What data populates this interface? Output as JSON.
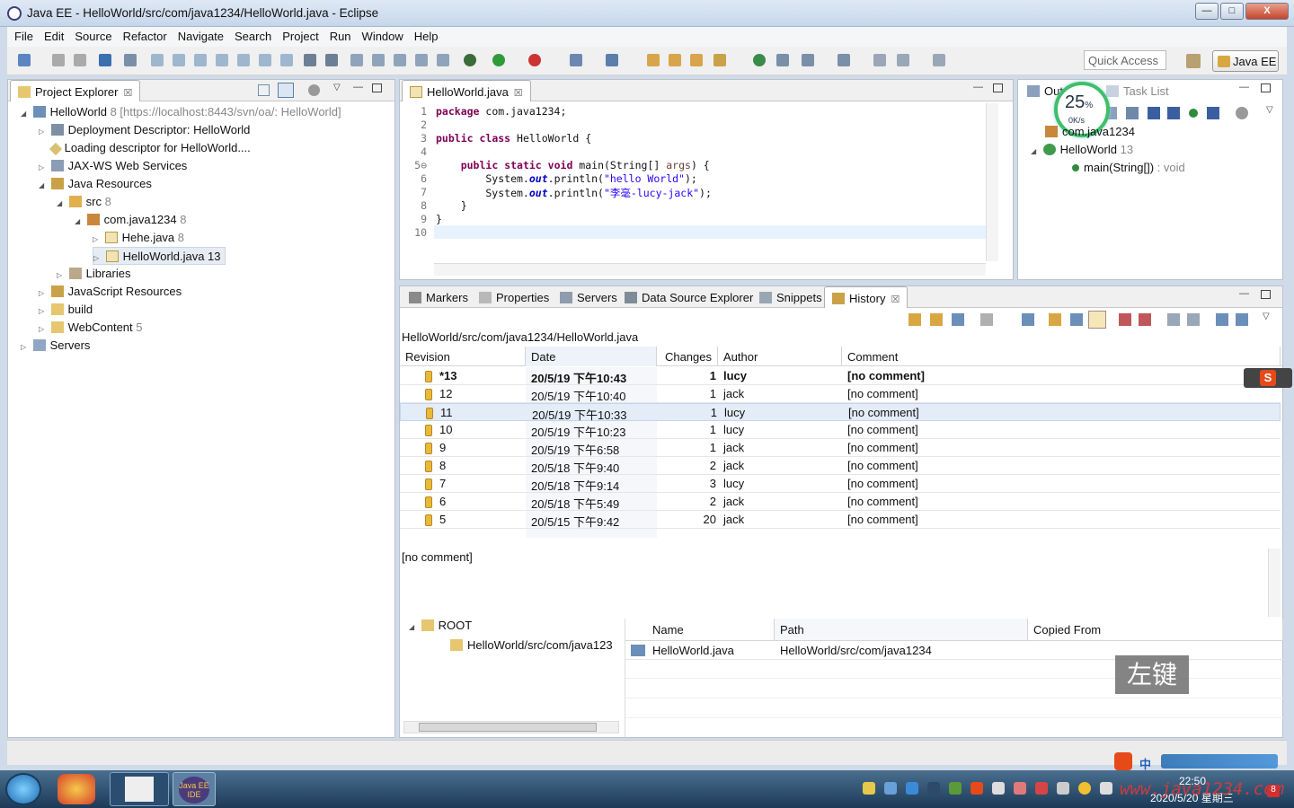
{
  "window": {
    "title": "Java EE - HelloWorld/src/com/java1234/HelloWorld.java - Eclipse",
    "controls": [
      "—",
      "□",
      "X"
    ]
  },
  "menu": [
    "File",
    "Edit",
    "Source",
    "Refactor",
    "Navigate",
    "Search",
    "Project",
    "Run",
    "Window",
    "Help"
  ],
  "toolbar": {
    "quick_access": "Quick Access",
    "perspective": "Java EE"
  },
  "project_explorer": {
    "title": "Project Explorer",
    "items": [
      {
        "label": "HelloWorld",
        "extra": "8 [https://localhost:8443/svn/oa/: HelloWorld]"
      },
      {
        "label": "Deployment Descriptor: HelloWorld",
        "extra": ""
      },
      {
        "label": "Loading descriptor for HelloWorld....",
        "extra": ""
      },
      {
        "label": "JAX-WS Web Services",
        "extra": ""
      },
      {
        "label": "Java Resources",
        "extra": ""
      },
      {
        "label": "src",
        "extra": "8"
      },
      {
        "label": "com.java1234",
        "extra": "8"
      },
      {
        "label": "Hehe.java",
        "extra": "8"
      },
      {
        "label": "HelloWorld.java",
        "extra": "13"
      },
      {
        "label": "Libraries",
        "extra": ""
      },
      {
        "label": "JavaScript Resources",
        "extra": ""
      },
      {
        "label": "build",
        "extra": ""
      },
      {
        "label": "WebContent",
        "extra": "5"
      },
      {
        "label": "Servers",
        "extra": ""
      }
    ]
  },
  "editor": {
    "tab": "HelloWorld.java",
    "line_numbers": [
      "1",
      "2",
      "3",
      "4",
      "5⊖",
      "6",
      "7",
      "8",
      "9",
      "10"
    ]
  },
  "outline": {
    "tabs": [
      "Out",
      "Task List"
    ],
    "progress": {
      "value": "25",
      "unit": "%",
      "rate": "0K/s"
    },
    "items": [
      {
        "label": "com.java1234",
        "extra": ""
      },
      {
        "label": "HelloWorld",
        "extra": "13"
      },
      {
        "label": "main(String[])",
        "extra": " : void"
      }
    ]
  },
  "bottom_tabs": [
    "Markers",
    "Properties",
    "Servers",
    "Data Source Explorer",
    "Snippets",
    "History"
  ],
  "history": {
    "path": "HelloWorld/src/com/java1234/HelloWorld.java",
    "columns": [
      "Revision",
      "Date",
      "Changes",
      "Author",
      "Comment"
    ],
    "rows": [
      {
        "revision": "*13",
        "date": "20/5/19 下午10:43",
        "changes": "1",
        "author": "lucy",
        "comment": "[no comment]"
      },
      {
        "revision": "12",
        "date": "20/5/19 下午10:40",
        "changes": "1",
        "author": "jack",
        "comment": "[no comment]"
      },
      {
        "revision": "11",
        "date": "20/5/19 下午10:33",
        "changes": "1",
        "author": "lucy",
        "comment": "[no comment]"
      },
      {
        "revision": "10",
        "date": "20/5/19 下午10:23",
        "changes": "1",
        "author": "lucy",
        "comment": "[no comment]"
      },
      {
        "revision": "9",
        "date": "20/5/19 下午6:58",
        "changes": "1",
        "author": "jack",
        "comment": "[no comment]"
      },
      {
        "revision": "8",
        "date": "20/5/18 下午9:40",
        "changes": "2",
        "author": "jack",
        "comment": "[no comment]"
      },
      {
        "revision": "7",
        "date": "20/5/18 下午9:14",
        "changes": "3",
        "author": "lucy",
        "comment": "[no comment]"
      },
      {
        "revision": "6",
        "date": "20/5/18 下午5:49",
        "changes": "2",
        "author": "jack",
        "comment": "[no comment]"
      },
      {
        "revision": "5",
        "date": "20/5/15 下午9:42",
        "changes": "20",
        "author": "jack",
        "comment": "[no comment]"
      }
    ],
    "comment_text": "[no comment]",
    "tree_root": "ROOT",
    "tree_child": "HelloWorld/src/com/java123",
    "file_columns": [
      "Name",
      "Path",
      "Copied From"
    ],
    "file_rows": [
      {
        "name": "HelloWorld.java",
        "path": "HelloWorld/src/com/java1234",
        "copied_from": ""
      }
    ]
  },
  "overlay": {
    "left_click_label": "左键",
    "ime_badge": "S"
  },
  "taskbar": {
    "time": "22:50",
    "date": "2020/5/20 星期三",
    "ime": "中",
    "watermark": "www.java1234.com",
    "badge": "8",
    "app_label": "Java EE IDE"
  }
}
